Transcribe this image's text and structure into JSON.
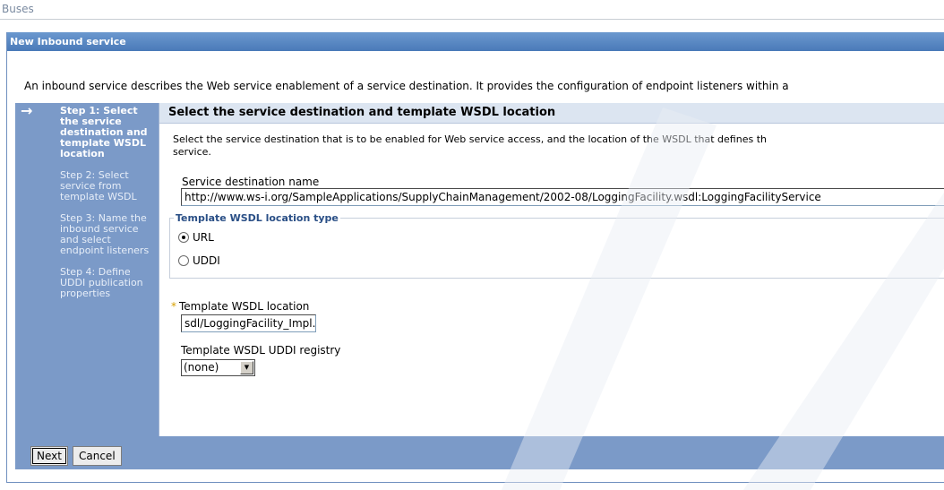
{
  "breadcrumb": "Buses",
  "panel_title": "New Inbound service",
  "intro": "An inbound service describes the Web service enablement of a service destination. It provides the configuration of endpoint listeners within a",
  "steps": [
    {
      "label": "Step 1: Select the service destination and template WSDL location",
      "current": true
    },
    {
      "label": "Step 2: Select service from template WSDL",
      "current": false
    },
    {
      "label": "Step 3: Name the inbound service and select endpoint listeners",
      "current": false
    },
    {
      "label": "Step 4: Define UDDI publication properties",
      "current": false
    }
  ],
  "content": {
    "title": "Select the service destination and template WSDL location",
    "description": "Select the service destination that is to be enabled for Web service access, and the location of the WSDL that defines th\nservice.",
    "service_destination_label": "Service destination name",
    "service_destination_value": "http://www.ws-i.org/SampleApplications/SupplyChainManagement/2002-08/LoggingFacility.wsdl:LoggingFacilityService",
    "location_type_legend": "Template WSDL location type",
    "radio_url_label": "URL",
    "radio_uddi_label": "UDDI",
    "required_marker": "*",
    "wsdl_location_label": "Template WSDL location",
    "wsdl_location_value": "sdl/LoggingFacility_Impl.wsdl",
    "uddi_registry_label": "Template WSDL UDDI registry",
    "uddi_registry_selected": "(none)"
  },
  "buttons": {
    "next": "Next",
    "cancel": "Cancel"
  },
  "icons": {
    "current_step": "right-arrow-icon",
    "dropdown": "chevron-down-icon",
    "arrow_glyph": "→",
    "dropdown_glyph": "▼"
  },
  "colors": {
    "title_bar": "#4a7ab8",
    "step_sidebar": "#7b9ac8",
    "content_header": "#dce5f1",
    "legend_text": "#2a4f86",
    "required_marker": "#d8a000"
  }
}
